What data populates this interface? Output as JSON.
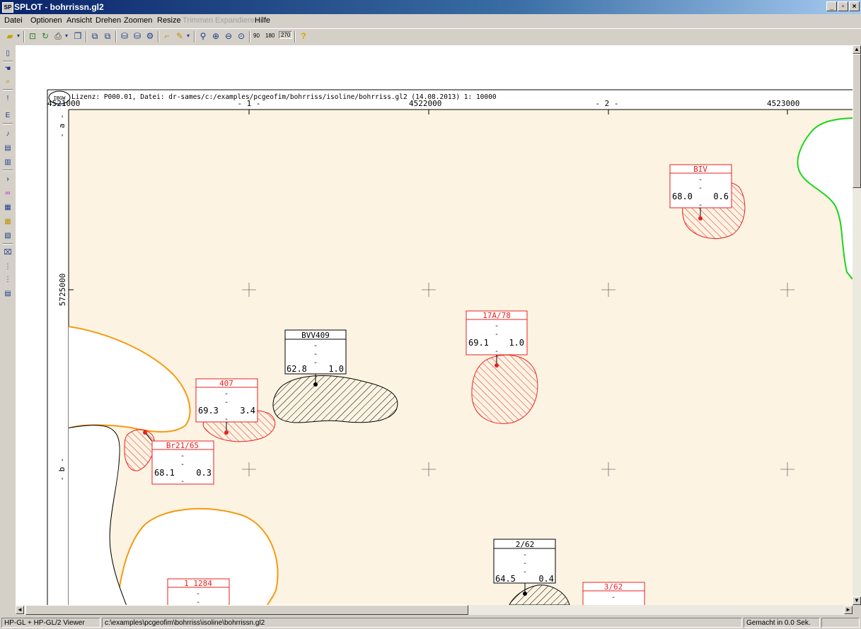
{
  "window": {
    "title": "SPLOT - bohrrissn.gl2",
    "app_icon_label": "SP",
    "controls": [
      "_",
      "▫",
      "×"
    ]
  },
  "menu": [
    {
      "label": "Datei",
      "enabled": true
    },
    {
      "label": "Optionen",
      "enabled": true
    },
    {
      "label": "Ansicht",
      "enabled": true
    },
    {
      "label": "Drehen",
      "enabled": true
    },
    {
      "label": "Zoomen",
      "enabled": true
    },
    {
      "label": "Resize",
      "enabled": true
    },
    {
      "label": "Trimmen",
      "enabled": false
    },
    {
      "label": "Expandieren",
      "enabled": false
    },
    {
      "label": "Hilfe",
      "enabled": true
    }
  ],
  "toolbar": {
    "icons": [
      "open-icon",
      "dropdown-arrow-icon",
      "print-preview-icon",
      "refresh-icon",
      "print-icon",
      "dropdown-arrow-icon",
      "copy-window-icon",
      "copy-icon",
      "paste-icon",
      "export-icon",
      "import-icon",
      "settings-icon",
      "measure-icon",
      "pencil-icon",
      "dropdown-arrow-icon",
      "distance-icon",
      "zoom-in-icon",
      "zoom-out-icon",
      "zoom-fit-icon",
      "help-icon"
    ],
    "rotate_90": "90",
    "rotate_180": "180",
    "rotate_270": "270"
  },
  "map": {
    "header": "Lizenz: P000.01, Datei: dr-sames/c:/examples/pcgeofim/bohrriss/isoline/bohrriss.gl2 (14.08.2013) 1: 10000",
    "logo_text": "IBGW",
    "logo_subtext": "Leipzig",
    "x_coords": [
      "4521000",
      "4522000",
      "4523000"
    ],
    "x_grid_labels": [
      "- 1 -",
      "- 2 -"
    ],
    "y_grid_labels": [
      "- a -",
      "- b -"
    ],
    "y_coord": "5725000",
    "colors": {
      "background": "#fdf3e2",
      "red": "#e8211f",
      "orange": "#f59a12",
      "green": "#19d61b",
      "black": "#000000"
    },
    "wells": [
      {
        "name": "BIV",
        "color": "red",
        "dash1": "-",
        "dash2": "-",
        "value1": "68.0",
        "value2": "0.6",
        "dash3": "-"
      },
      {
        "name": "17A/78",
        "color": "red",
        "dash1": "-",
        "dash2": "-",
        "value1": "69.1",
        "value2": "1.0",
        "dash3": "-"
      },
      {
        "name": "BVV409",
        "color": "black",
        "dash1": "-",
        "dash2": "-",
        "value1": "62.8",
        "value2": "1.0",
        "dash3": "-"
      },
      {
        "name": "407",
        "color": "red",
        "dash1": "-",
        "dash2": "-",
        "value1": "69.3",
        "value2": "3.4",
        "dash3": "-"
      },
      {
        "name": "Br21/65",
        "color": "red",
        "dash1": "-",
        "dash2": "-",
        "value1": "68.1",
        "value2": "0.3",
        "dash3": "-"
      },
      {
        "name": "2/62",
        "color": "black",
        "dash1": "-",
        "dash2": "-",
        "value1": "64.5",
        "value2": "0.4",
        "dash3": "-"
      },
      {
        "name": "3/62",
        "color": "red",
        "dash1": "-",
        "dash2": "-",
        "value1": "",
        "value2": "",
        "dash3": ""
      },
      {
        "name": "1_1284",
        "color": "red",
        "dash1": "-",
        "dash2": "-",
        "value1": "",
        "value2": "",
        "dash3": ""
      }
    ]
  },
  "statusbar": {
    "format": "HP-GL + HP-GL/2 Viewer",
    "path": "c:\\examples\\pcgeofim\\bohrriss\\isoline\\bohrrissn.gl2",
    "timing": "Gemacht in 0.0 Sek."
  }
}
